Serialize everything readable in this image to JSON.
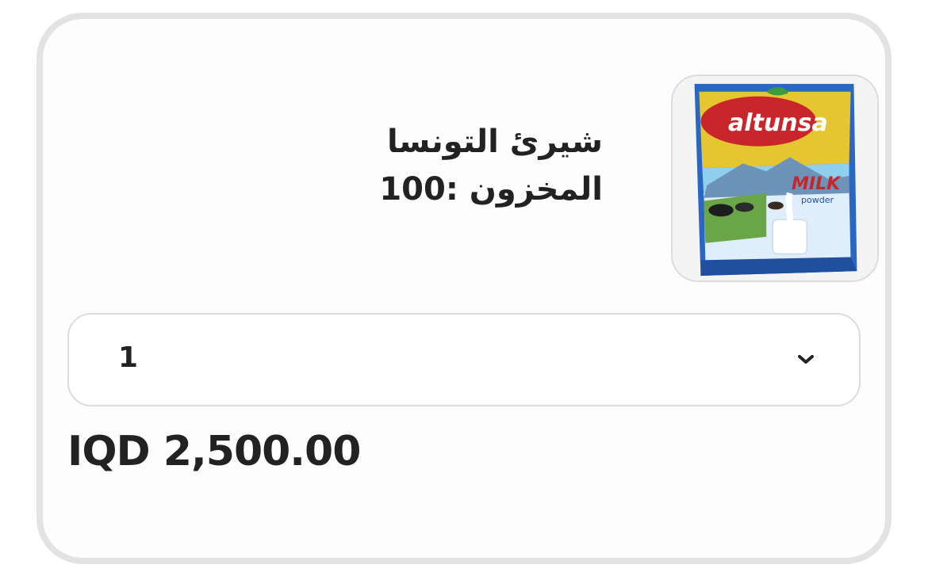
{
  "product": {
    "title": "شيرئ التونسا",
    "stock": "المخزون :100",
    "image": {
      "icon": "milk-powder-package-photo",
      "brand_text": "altunsa",
      "product_text": "MILK",
      "sub_text": "powder"
    }
  },
  "quantity": {
    "selected": "1",
    "icon": "chevron-down-icon"
  },
  "price": {
    "text": "IQD 2,500.00"
  },
  "colors": {
    "card_border": "#e3e3e3",
    "text": "#222222",
    "field_border": "#dcdcdc",
    "pack_yellow": "#e8c832",
    "pack_blue": "#1f5fb8",
    "brand_red": "#c9262b"
  }
}
